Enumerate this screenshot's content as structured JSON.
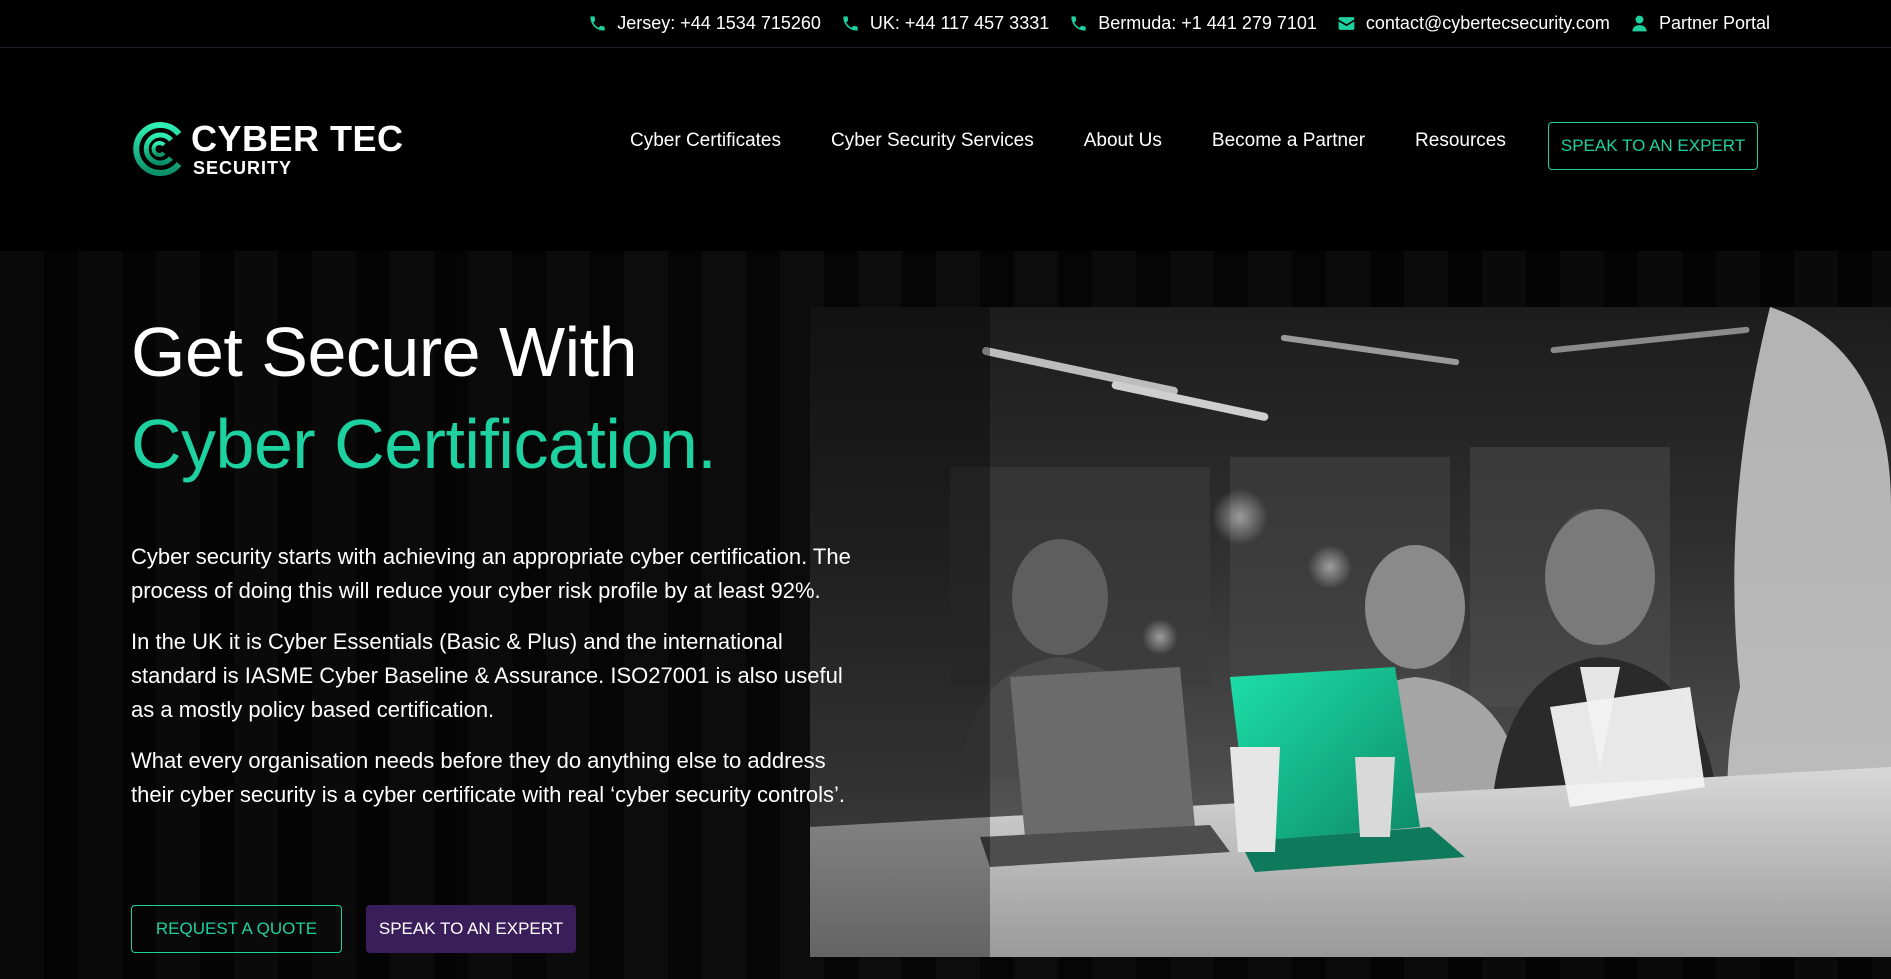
{
  "topbar": {
    "contacts": [
      {
        "icon": "phone-icon",
        "label": "Jersey: +44 1534 715260"
      },
      {
        "icon": "phone-icon",
        "label": "UK: +44 117 457 3331"
      },
      {
        "icon": "phone-icon",
        "label": "Bermuda: +1 441 279 7101"
      },
      {
        "icon": "envelope-icon",
        "label": "contact@cybertecsecurity.com"
      },
      {
        "icon": "user-icon",
        "label": "Partner Portal"
      }
    ]
  },
  "logo": {
    "name": "CYBER TEC",
    "sub": "SECURITY"
  },
  "nav": {
    "items": [
      {
        "label": "Cyber Certificates"
      },
      {
        "label": "Cyber Security Services"
      },
      {
        "label": "About Us"
      },
      {
        "label": "Become a Partner"
      },
      {
        "label": "Resources"
      }
    ],
    "cta": "SPEAK TO AN EXPERT"
  },
  "hero": {
    "title_line1": "Get Secure With",
    "title_line2": "Cyber Certification.",
    "paragraphs": [
      "Cyber security starts with achieving an appropriate cyber certification. The process of doing this will reduce your cyber risk profile by at least 92%.",
      "In the UK it is Cyber Essentials (Basic & Plus) and the international standard is IASME Cyber Baseline & Assurance. ISO27001 is also useful as a mostly policy based certification.",
      "What every organisation needs before they do anything else to address their cyber security is a cyber certificate with real ‘cyber security controls’."
    ],
    "quote_button": "REQUEST A QUOTE",
    "expert_button": "SPEAK TO AN EXPERT"
  },
  "colors": {
    "accent": "#1ed1a0",
    "background": "#000000",
    "secondary_button": "#3a1e5a"
  }
}
